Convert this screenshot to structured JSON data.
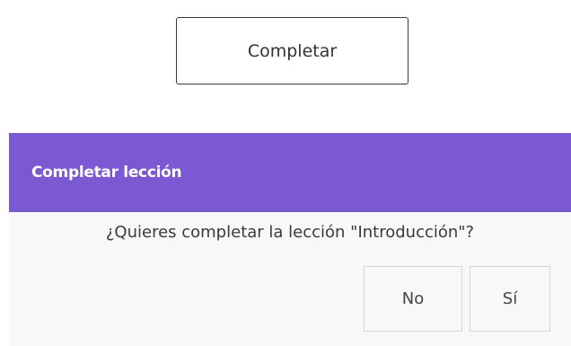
{
  "complete_button": {
    "label": "Completar"
  },
  "dialog": {
    "title": "Completar lección",
    "message": "¿Quieres completar la lección \"Introducción\"?",
    "buttons": {
      "no_label": "No",
      "yes_label": "Sí"
    }
  },
  "colors": {
    "header_background": "#7b59d3",
    "header_text": "#ffffff",
    "dialog_background": "#f8f8f8",
    "button_border": "#3a3a3a"
  }
}
